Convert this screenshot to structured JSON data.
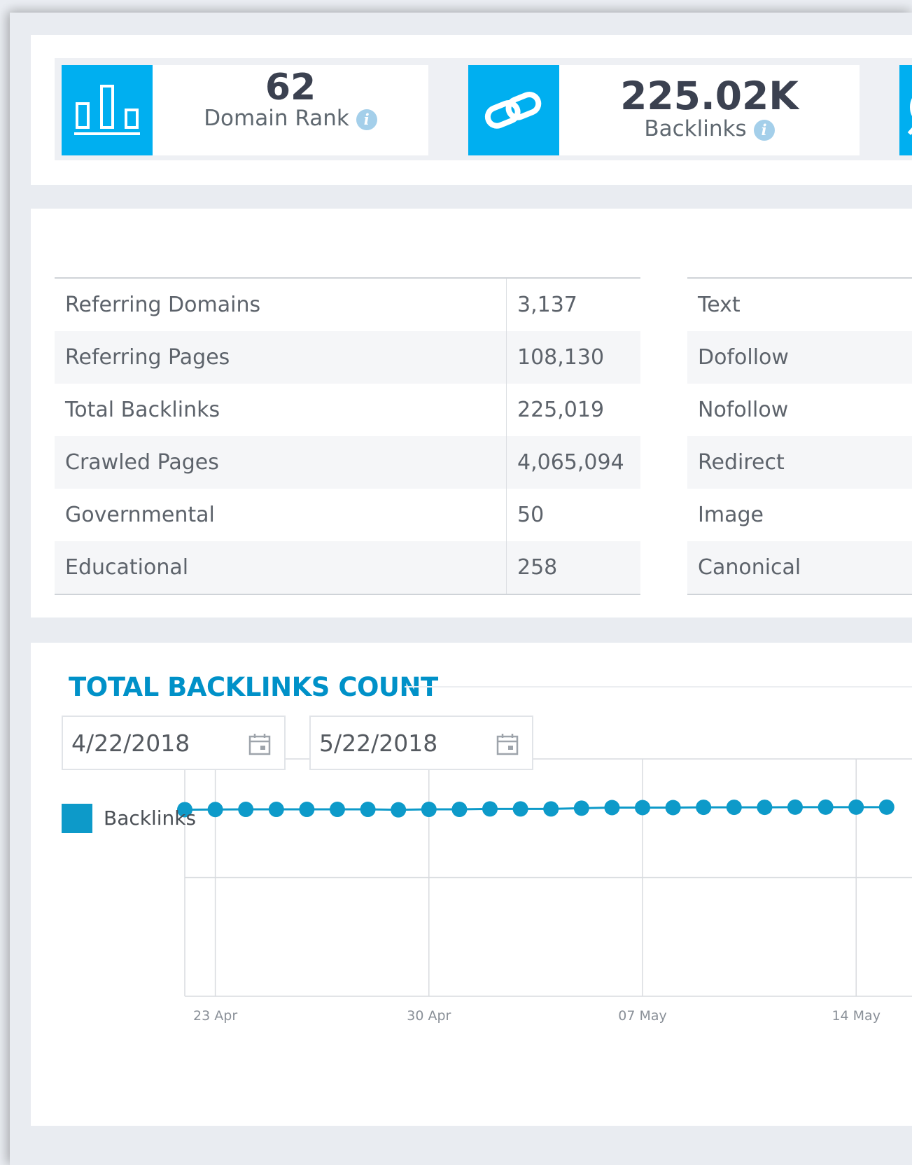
{
  "stats": [
    {
      "value": "62",
      "label": "Domain Rank",
      "icon": "bar-chart-icon"
    },
    {
      "value": "225.02K",
      "label": "Backlinks",
      "icon": "link-icon"
    },
    {
      "icon": "globe-icon"
    }
  ],
  "left_table": [
    {
      "label": "Referring Domains",
      "value": "3,137"
    },
    {
      "label": "Referring Pages",
      "value": "108,130"
    },
    {
      "label": "Total Backlinks",
      "value": "225,019"
    },
    {
      "label": "Crawled Pages",
      "value": "4,065,094"
    },
    {
      "label": "Governmental",
      "value": "50"
    },
    {
      "label": "Educational",
      "value": "258"
    }
  ],
  "right_table": [
    "Text",
    "Dofollow",
    "Nofollow",
    "Redirect",
    "Image",
    "Canonical"
  ],
  "backlinks_section": {
    "title": "TOTAL BACKLINKS COUNT",
    "start_date": "4/22/2018",
    "end_date": "5/22/2018",
    "legend_label": "Backlinks"
  },
  "colors": {
    "accent": "#00aff0",
    "series": "#0d9ac9",
    "title": "#0091c8"
  },
  "chart_data": {
    "type": "line",
    "title": "TOTAL BACKLINKS COUNT",
    "xlabel": "",
    "ylabel": "",
    "x_ticks": [
      "23 Apr",
      "30 Apr",
      "07 May",
      "14 May"
    ],
    "x": [
      "2018-04-22",
      "2018-04-23",
      "2018-04-24",
      "2018-04-25",
      "2018-04-26",
      "2018-04-27",
      "2018-04-28",
      "2018-04-29",
      "2018-04-30",
      "2018-05-01",
      "2018-05-02",
      "2018-05-03",
      "2018-05-04",
      "2018-05-05",
      "2018-05-06",
      "2018-05-07",
      "2018-05-08",
      "2018-05-09",
      "2018-05-10",
      "2018-05-11",
      "2018-05-12",
      "2018-05-13",
      "2018-05-14",
      "2018-05-15"
    ],
    "series": [
      {
        "name": "Backlinks",
        "values": [
          222900,
          222950,
          223000,
          223000,
          223000,
          223000,
          223000,
          222850,
          223000,
          223000,
          223150,
          223150,
          223150,
          223400,
          223600,
          223600,
          223600,
          223700,
          223700,
          223700,
          223750,
          223750,
          223750,
          223750
        ]
      }
    ],
    "ylim": [
      160000,
      240000
    ],
    "grid": true,
    "legend": "top-left"
  }
}
